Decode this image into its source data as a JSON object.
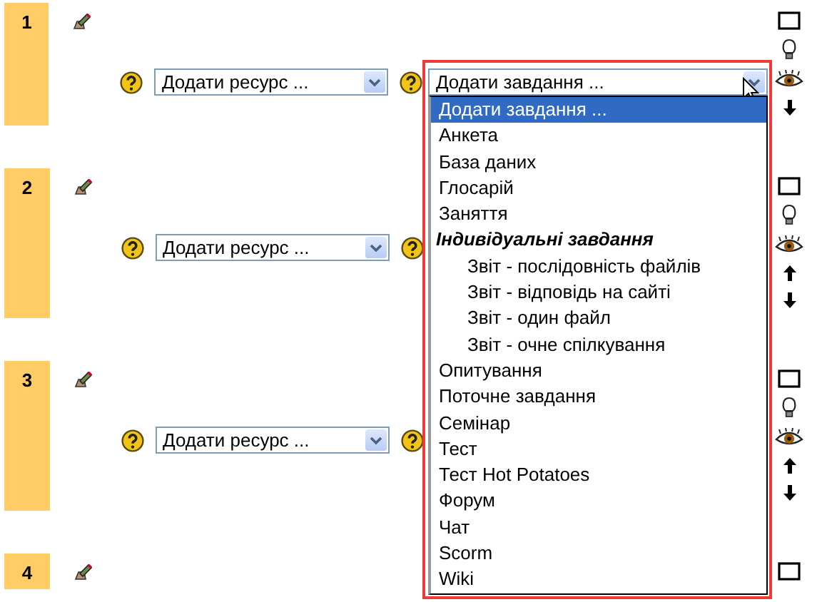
{
  "sections": [
    {
      "number": "1",
      "resource_select": {
        "value": "Додати ресурс ..."
      },
      "activity_select": {
        "value": "Додати завдання ...",
        "open": true,
        "options": [
          {
            "label": "Додати завдання ...",
            "kind": "option",
            "selected": true
          },
          {
            "label": "Анкета",
            "kind": "option",
            "selected": false
          },
          {
            "label": "База даних",
            "kind": "option",
            "selected": false
          },
          {
            "label": "Глосарій",
            "kind": "option",
            "selected": false
          },
          {
            "label": "Заняття",
            "kind": "option",
            "selected": false
          },
          {
            "label": "Індивідуальні завдання",
            "kind": "group",
            "selected": false
          },
          {
            "label": "Звіт - послідовність файлів",
            "kind": "suboption",
            "selected": false
          },
          {
            "label": "Звіт - відповідь на сайті",
            "kind": "suboption",
            "selected": false
          },
          {
            "label": "Звіт - один файл",
            "kind": "suboption",
            "selected": false
          },
          {
            "label": "Звіт - очне спілкування",
            "kind": "suboption",
            "selected": false
          },
          {
            "label": "Опитування",
            "kind": "option",
            "selected": false
          },
          {
            "label": "Поточне завдання",
            "kind": "option",
            "selected": false
          },
          {
            "label": "Семінар",
            "kind": "option",
            "selected": false
          },
          {
            "label": "Тест",
            "kind": "option",
            "selected": false
          },
          {
            "label": "Тест Hot Potatoes",
            "kind": "option",
            "selected": false
          },
          {
            "label": "Форум",
            "kind": "option",
            "selected": false
          },
          {
            "label": "Чат",
            "kind": "option",
            "selected": false
          },
          {
            "label": "Scorm",
            "kind": "option",
            "selected": false
          },
          {
            "label": "Wiki",
            "kind": "option",
            "selected": false
          }
        ]
      },
      "controls": [
        {
          "kind": "hide"
        },
        {
          "kind": "highlight"
        },
        {
          "kind": "visibility"
        },
        {
          "kind": "move_down"
        }
      ]
    },
    {
      "number": "2",
      "resource_select": {
        "value": "Додати ресурс ..."
      },
      "controls": [
        {
          "kind": "hide"
        },
        {
          "kind": "highlight"
        },
        {
          "kind": "visibility"
        },
        {
          "kind": "move_up"
        },
        {
          "kind": "move_down"
        }
      ]
    },
    {
      "number": "3",
      "resource_select": {
        "value": "Додати ресурс ..."
      },
      "controls": [
        {
          "kind": "hide"
        },
        {
          "kind": "highlight"
        },
        {
          "kind": "visibility"
        },
        {
          "kind": "move_up"
        },
        {
          "kind": "move_down"
        }
      ]
    },
    {
      "number": "4",
      "controls": [
        {
          "kind": "hide"
        }
      ]
    }
  ]
}
